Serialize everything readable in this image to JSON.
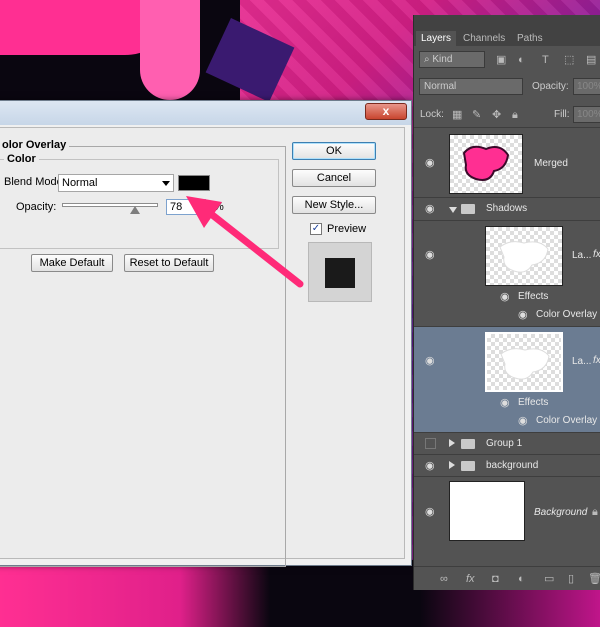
{
  "dialog": {
    "section_title": "olor Overlay",
    "group_title": "Color",
    "blend_mode_label": "Blend Mode:",
    "blend_mode_value": "Normal",
    "overlay_color": "#000000",
    "opacity_label": "Opacity:",
    "opacity_value": "78",
    "opacity_unit": "%",
    "make_default": "Make Default",
    "reset_default": "Reset to Default",
    "ok": "OK",
    "cancel": "Cancel",
    "new_style": "New Style...",
    "preview_label": "Preview",
    "preview_checked": true,
    "close_icon": "x"
  },
  "layers_panel": {
    "tabs": [
      "Layers",
      "Channels",
      "Paths"
    ],
    "active_tab": "Layers",
    "filter_kind": "Kind",
    "blend_mode": "Normal",
    "opacity_label": "Opacity:",
    "opacity_value": "100%",
    "lock_label": "Lock:",
    "fill_label": "Fill:",
    "fill_value": "100%",
    "layers": [
      {
        "name": "Merged"
      },
      {
        "name": "Shadows"
      },
      {
        "name": "La...",
        "fx": "fx",
        "effects_label": "Effects",
        "effect": "Color Overlay"
      },
      {
        "name": "La...",
        "fx": "fx",
        "effects_label": "Effects",
        "effect": "Color Overlay",
        "selected": true
      },
      {
        "name": "Group 1"
      },
      {
        "name": "background"
      },
      {
        "name": "Background"
      }
    ],
    "bottom_icons": [
      "link-icon",
      "fx-icon",
      "mask-icon",
      "adjustment-icon",
      "folder-icon",
      "new-layer-icon",
      "trash-icon"
    ]
  },
  "colors": {
    "accent_arrow": "#ff2a78",
    "selected_layer": "#6b7c92",
    "panel_bg": "#535353"
  }
}
